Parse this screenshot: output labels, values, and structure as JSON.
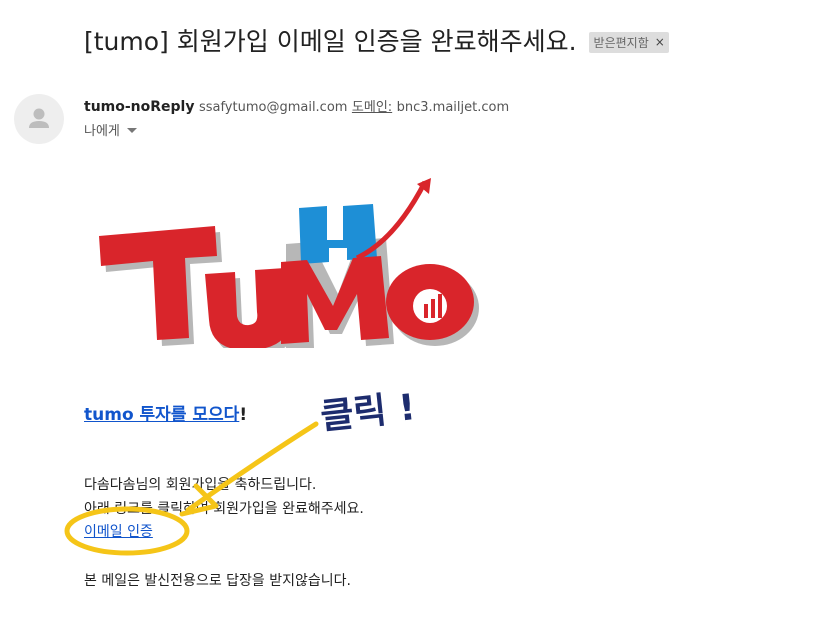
{
  "email": {
    "subject": "[tumo] 회원가입 이메일 인증을 완료해주세요.",
    "label": "받은편지함",
    "label_close": "×",
    "sender_name": "tumo-noReply",
    "sender_email": "ssafytumo@gmail.com",
    "via_label": "도메인:",
    "via_domain": "bnc3.mailjet.com",
    "recipient": "나에게"
  },
  "body": {
    "logo_text": "TuMo",
    "tagline_link": "tumo 투자를 모으다",
    "tagline_suffix": "!",
    "congrats": "다솜다솜님의 회원가입을 축하드립니다.",
    "instruction": "아래 링크를 클릭하여 회원가입을 완료해주세요.",
    "verify_link": "이메일 인증",
    "notice": "본 메일은 발신전용으로 답장을 받지않습니다."
  },
  "annotation": {
    "text": "클릭 !",
    "color": "#f5c518"
  },
  "colors": {
    "logo_red": "#d9252b",
    "logo_blue": "#1e8fd6",
    "link_blue": "#1155cc"
  }
}
